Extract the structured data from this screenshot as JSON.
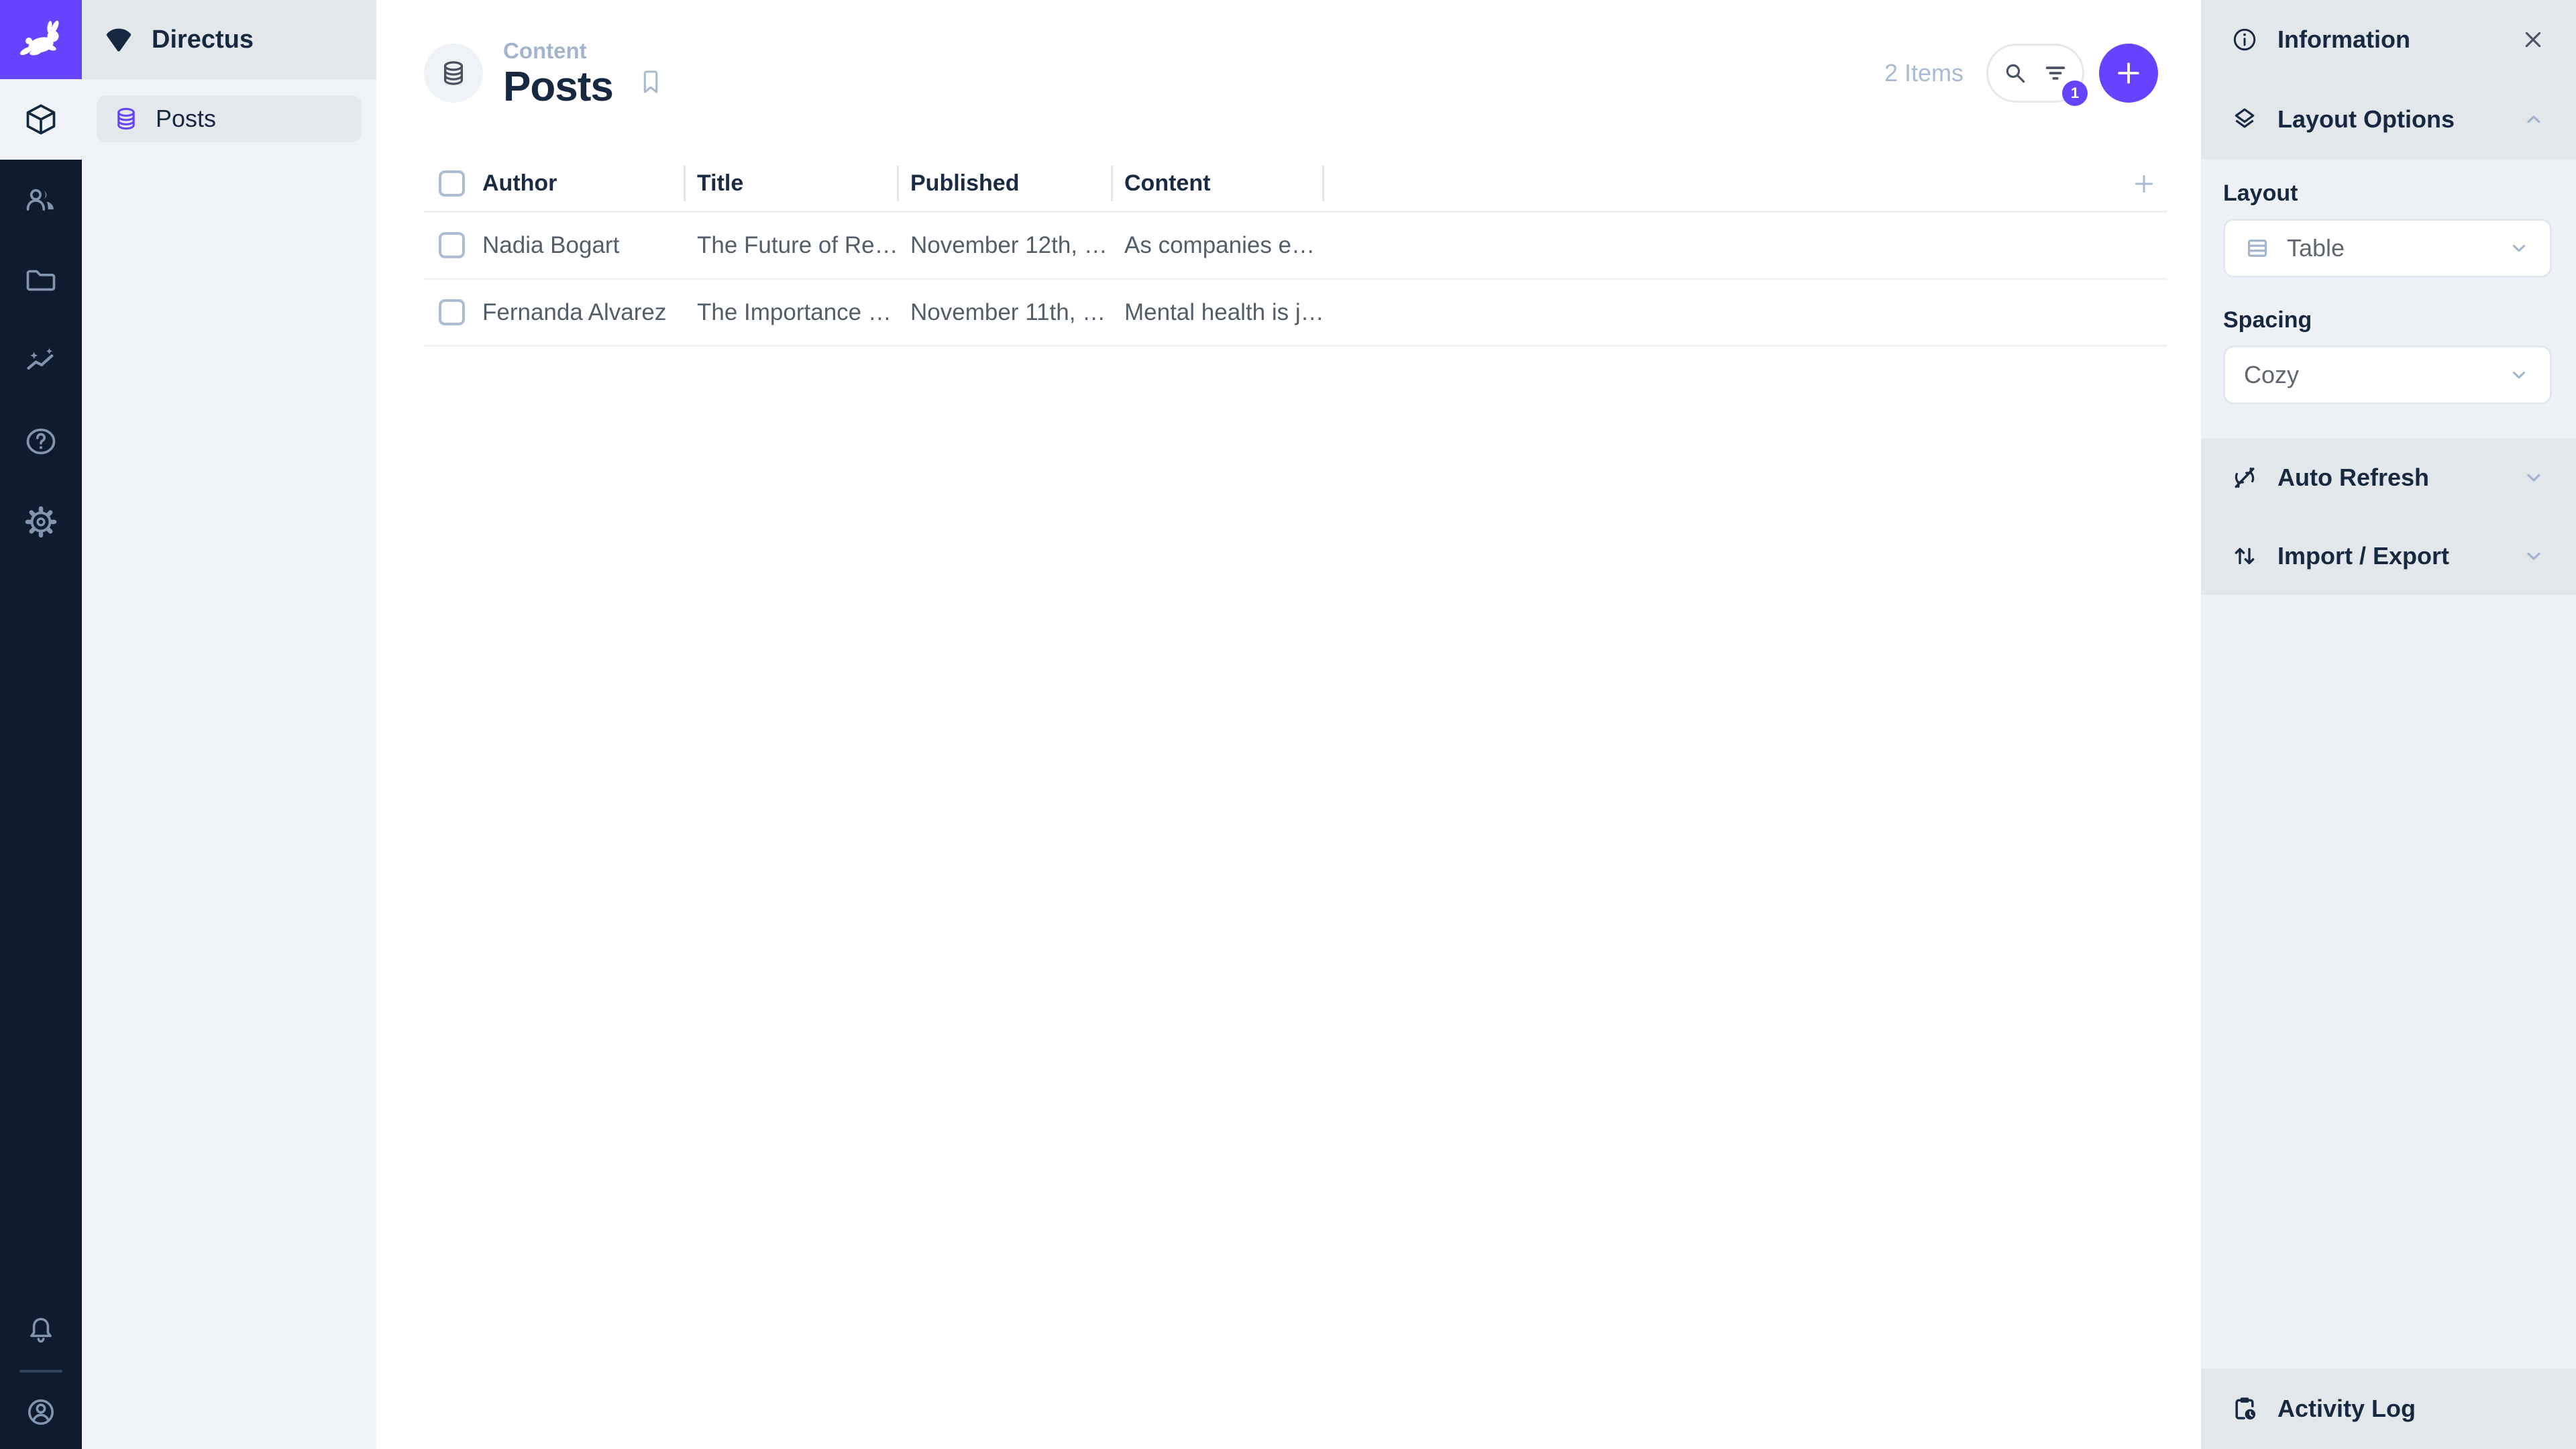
{
  "colors": {
    "brand_purple": "#6644ff",
    "module_bar_bg": "#0e1c2e",
    "module_icon": "#8196ae",
    "sidebar_bg": "#eff3f7",
    "panel_gray": "#e2e7ec",
    "panel_light": "#eef2f6",
    "dark_text": "#172940",
    "muted_blue": "#a2b5cd",
    "body_text": "#545d6a"
  },
  "module_bar": {
    "logo_icon": "directus-rabbit-icon",
    "modules": [
      {
        "icon": "cube-icon",
        "active": true
      },
      {
        "icon": "users-icon",
        "active": false
      },
      {
        "icon": "folder-icon",
        "active": false
      },
      {
        "icon": "insights-icon",
        "active": false
      },
      {
        "icon": "help-icon",
        "active": false
      },
      {
        "icon": "settings-icon",
        "active": false
      }
    ],
    "bottom_icons": [
      "bell-icon",
      "account-icon"
    ]
  },
  "nav": {
    "project_name": "Directus",
    "items": [
      {
        "label": "Posts",
        "icon": "database-icon",
        "active": true
      }
    ]
  },
  "header": {
    "breadcrumb": "Content",
    "title": "Posts",
    "items_count": "2 Items",
    "filter_badge": "1"
  },
  "table": {
    "columns": [
      "Author",
      "Title",
      "Published",
      "Content"
    ],
    "rows": [
      {
        "author": "Nadia Bogart",
        "title": "The Future of Re…",
        "published": "November 12th, …",
        "content": "As companies e…"
      },
      {
        "author": "Fernanda Alvarez",
        "title": "The Importance …",
        "published": "November 11th, …",
        "content": "Mental health is j…"
      }
    ]
  },
  "sidebar": {
    "title": "Information",
    "layout_options": {
      "label": "Layout Options",
      "layout_label": "Layout",
      "layout_value": "Table",
      "spacing_label": "Spacing",
      "spacing_value": "Cozy"
    },
    "accordions": [
      {
        "label": "Auto Refresh",
        "icon": "sync-disabled-icon"
      },
      {
        "label": "Import / Export",
        "icon": "import-export-icon"
      }
    ],
    "activity_log_label": "Activity Log"
  }
}
